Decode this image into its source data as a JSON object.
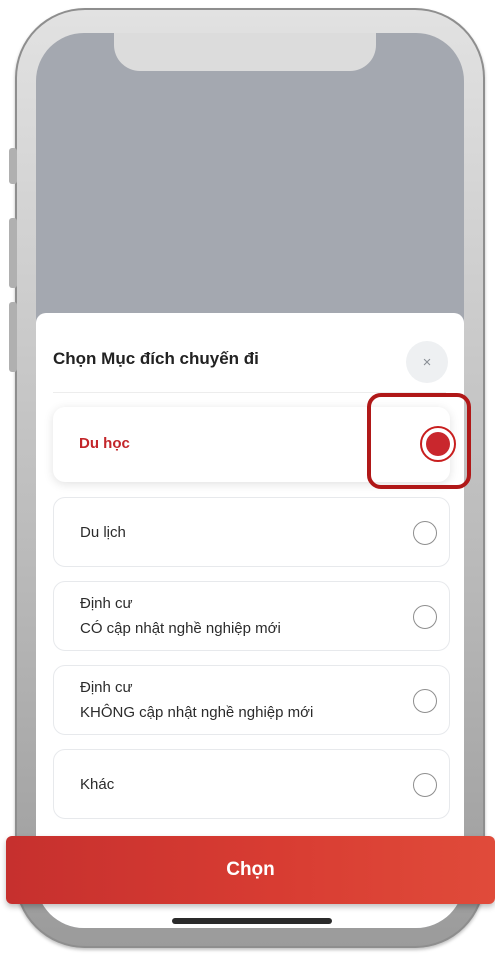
{
  "sheet": {
    "title": "Chọn Mục đích chuyến đi",
    "close_icon": "×"
  },
  "options": [
    {
      "line1": "Du học",
      "line2": "",
      "selected": true
    },
    {
      "line1": "Du lịch",
      "line2": "",
      "selected": false
    },
    {
      "line1": "Định cư",
      "line2": "CÓ cập nhật nghề nghiệp mới",
      "selected": false
    },
    {
      "line1": "Định cư",
      "line2": "KHÔNG cập nhật nghề nghiệp mới",
      "selected": false
    },
    {
      "line1": "Khác",
      "line2": "",
      "selected": false
    }
  ],
  "footer": {
    "choose_label": "Chọn"
  },
  "colors": {
    "accent": "#c9272d",
    "backdrop": "#a4a8b0"
  }
}
